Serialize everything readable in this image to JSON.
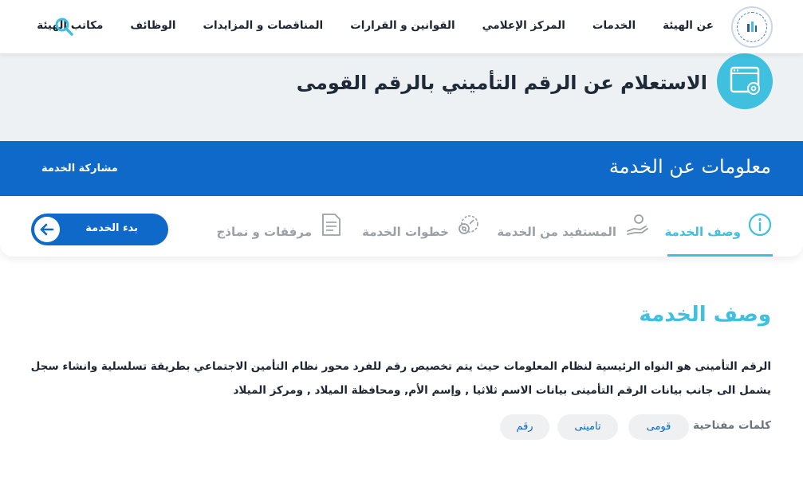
{
  "nav": {
    "items": [
      "عن الهيئة",
      "الخدمات",
      "المركز الإعلامي",
      "القوانين و القرارات",
      "المناقصات و المزايدات",
      "الوظائف",
      "مكاتب الهيئة"
    ],
    "search_icon": "search-icon"
  },
  "header": {
    "title": "الاستعلام عن الرقم التأميني بالرقم القومى"
  },
  "service_info": {
    "title": "معلومات عن الخدمة",
    "share_label": "مشاركة الخدمة"
  },
  "tabs": [
    {
      "label": "وصف الخدمة",
      "icon": "info-icon",
      "active": true
    },
    {
      "label": "المستفيد من الخدمة",
      "icon": "beneficiary-icon",
      "active": false
    },
    {
      "label": "خطوات الخدمة",
      "icon": "steps-gear-icon",
      "active": false
    },
    {
      "label": "مرفقات و نماذج",
      "icon": "document-icon",
      "active": false
    }
  ],
  "start_button": {
    "label": "بدء الخدمة"
  },
  "section": {
    "title": "وصف الخدمة",
    "description": "الرقم التأمينى هو النواه الرئيسية لنظام المعلومات حيث يتم تخصيص رقم للفرد محور نظام التأمين الاجتماعي  بطريقة تسلسلية وانشاء سجل يشمل الى جانب بيانات الرقم التأمينى بيانات الاسم ثلاثيا , وإسم الأم, ومحافظة الميلاد , ومركز الميلاد",
    "keywords_label": "كلمات مفتاحية :",
    "keywords": [
      "قومى",
      "تامينى",
      "رقم"
    ]
  },
  "colors": {
    "accent": "#3ec0de",
    "primary": "#0e69c9",
    "band": "#eef1f4"
  }
}
